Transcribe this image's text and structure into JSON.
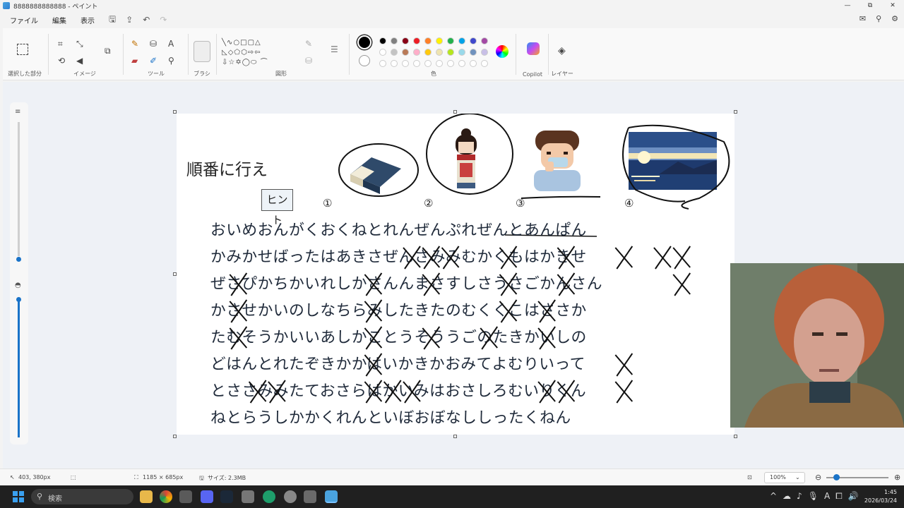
{
  "window": {
    "title": "8888888888888 - ペイント",
    "controls": [
      "—",
      "⧉",
      "✕"
    ]
  },
  "menu": {
    "items": [
      "ファイル",
      "編集",
      "表示"
    ]
  },
  "ribbon": {
    "groups": {
      "selection": "選択した部分",
      "image": "イメージ",
      "tools": "ツール",
      "brush": "ブラシ",
      "shapes": "図形",
      "colors": "色",
      "copilot": "Copilot",
      "layers": "レイヤー"
    },
    "shape_glyphs": "╲∿○□▢△ ◺◇⬠⬡⇨⇦ ⇩☆✡◯⬭ ⏜",
    "palette": [
      "#000000",
      "#7f7f7f",
      "#880015",
      "#ed1c24",
      "#ff7f27",
      "#fff200",
      "#22b14c",
      "#00a2e8",
      "#3f48cc",
      "#a349a4",
      "#ffffff",
      "#c3c3c3",
      "#b97a57",
      "#ffaec9",
      "#ffc90e",
      "#efe4b0",
      "#b5e61d",
      "#99d9ea",
      "#7092be",
      "#c8bfe7",
      "#ffffff",
      "#ffffff",
      "#ffffff",
      "#ffffff",
      "#ffffff",
      "#ffffff",
      "#ffffff",
      "#ffffff",
      "#ffffff",
      "#ffffff"
    ]
  },
  "puzzle": {
    "title": "順番に行え",
    "hint": "ヒント",
    "labels": [
      "①",
      "②",
      "③",
      "④"
    ],
    "rows": [
      "おいめおんがくおくねとれんぜんぷれぜんとあんぱん",
      "かみかせばったはあきさぜんさみみむかくもはかきせ",
      "ぜさぴかちかいれしかさんんまさすしさうさごかんさん",
      "かさせかいのしなちらみしたきたのむくくこはささか",
      "たむそうかいいあしかことうそううごのたきかいしの",
      "どはんとれたぞきかかはいかきかおみてよむりいって",
      "とささみみたておさらはかいみはおさしろむいりくん",
      "ねとらうしかかくれんといぼおぼなししったくねん"
    ]
  },
  "status": {
    "cursor": "403, 380px",
    "size": "1185 × 685px",
    "filesize": "サイズ: 2.3MB",
    "zoom": "100%"
  },
  "taskbar": {
    "search_placeholder": "検索",
    "time": "1:45",
    "date": "2026/03/24"
  }
}
